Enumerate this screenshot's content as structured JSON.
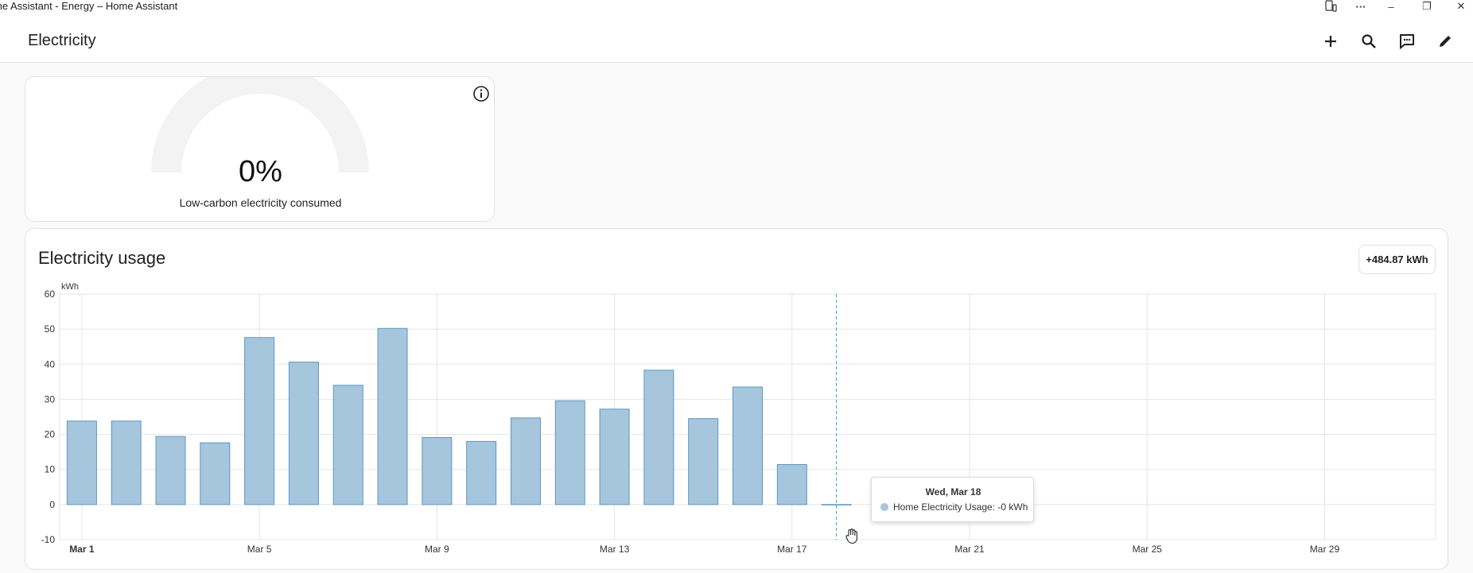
{
  "window": {
    "title": "me Assistant - Energy – Home Assistant",
    "controls": {
      "extension_icon": "phone-link-icon",
      "more_icon": "more-horizontal-icon",
      "minimize": "–",
      "restore": "❐",
      "close": "✕"
    }
  },
  "header": {
    "title": "Electricity",
    "actions": [
      "add-icon",
      "search-icon",
      "assist-icon",
      "edit-icon"
    ]
  },
  "gauge_card": {
    "value": "0%",
    "label": "Low-carbon electricity consumed",
    "fraction": 0,
    "info_icon": "info-icon"
  },
  "usage_card": {
    "title": "Electricity usage",
    "total": "+484.87 kWh"
  },
  "tooltip": {
    "date": "Wed, Mar 18",
    "text": "Home Electricity Usage: -0 kWh"
  },
  "colors": {
    "bar_fill": "#a6c6dd",
    "bar_stroke": "#5d97c0",
    "cursor_line": "#2a9fd6",
    "grid": "#e5e5e5"
  },
  "chart_data": {
    "type": "bar",
    "ylabel": "kWh",
    "ylim": [
      -10,
      60
    ],
    "yticks": [
      60,
      50,
      40,
      30,
      20,
      10,
      0,
      -10
    ],
    "x_tick_labels": [
      "Mar 1",
      "Mar 5",
      "Mar 9",
      "Mar 13",
      "Mar 17",
      "Mar 21",
      "Mar 25",
      "Mar 29"
    ],
    "x_tick_days": [
      1,
      5,
      9,
      13,
      17,
      21,
      25,
      29
    ],
    "xlim_days": [
      0.5,
      31.5
    ],
    "grid": true,
    "series": [
      {
        "name": "Home Electricity Usage",
        "x_days": [
          1,
          2,
          3,
          4,
          5,
          6,
          7,
          8,
          9,
          10,
          11,
          12,
          13,
          14,
          15,
          16,
          17,
          18
        ],
        "values": [
          23.8,
          23.8,
          19.4,
          17.6,
          47.6,
          40.6,
          34.0,
          50.2,
          19.1,
          18.0,
          24.7,
          29.6,
          27.2,
          38.3,
          24.5,
          33.5,
          11.4,
          0
        ]
      }
    ],
    "highlight_day": 18
  }
}
